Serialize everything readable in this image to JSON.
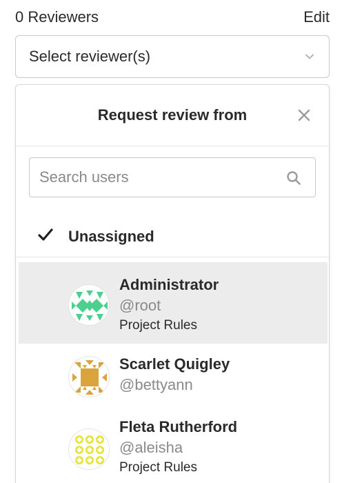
{
  "header": {
    "count_label": "0 Reviewers",
    "edit_label": "Edit"
  },
  "select": {
    "label": "Select reviewer(s)",
    "icon": "chevron-down-icon"
  },
  "dropdown": {
    "title": "Request review from",
    "close_icon": "close-icon",
    "search": {
      "placeholder": "Search users",
      "value": "",
      "icon": "search-icon"
    },
    "unassigned": {
      "label": "Unassigned",
      "checked": true
    },
    "users": [
      {
        "name": "Administrator",
        "handle": "@root",
        "rules": "Project Rules",
        "highlighted": true,
        "avatar_color": "#4ccf8f"
      },
      {
        "name": "Scarlet Quigley",
        "handle": "@bettyann",
        "rules": "",
        "highlighted": false,
        "avatar_color": "#d9a43c"
      },
      {
        "name": "Fleta Rutherford",
        "handle": "@aleisha",
        "rules": "Project Rules",
        "highlighted": false,
        "avatar_color": "#e6e33b"
      }
    ]
  }
}
